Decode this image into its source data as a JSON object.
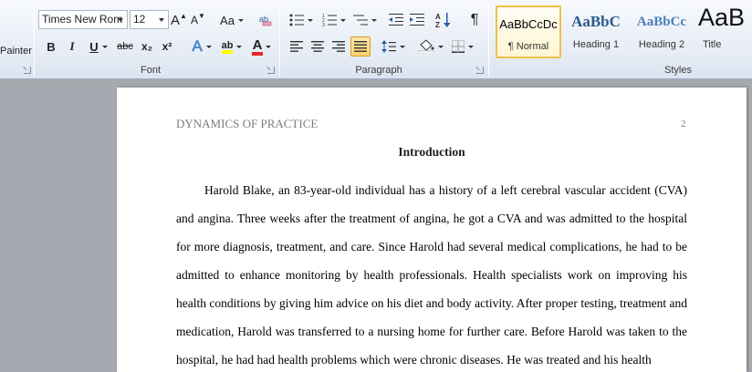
{
  "clipboard": {
    "format_painter_partial": "Painter"
  },
  "font": {
    "group_label": "Font",
    "family_value": "Times New Rom",
    "size_value": "12",
    "grow_label": "A",
    "shrink_label": "A",
    "case_label": "Aa",
    "bold": "B",
    "italic": "I",
    "underline": "U",
    "strike": "abc",
    "subscript": "x₂",
    "superscript": "x²",
    "effects": "A",
    "highlight": "ab",
    "color": "A",
    "highlight_color": "#ffff00",
    "font_color": "#e8262a"
  },
  "paragraph": {
    "group_label": "Paragraph",
    "pilcrow": "¶"
  },
  "styles": {
    "group_label": "Styles",
    "tiles": [
      {
        "preview": "AaBbCcDc",
        "name": "¶ Normal"
      },
      {
        "preview": "AaBbC",
        "name": "Heading 1"
      },
      {
        "preview": "AaBbCc",
        "name": "Heading 2"
      },
      {
        "preview": "AaB",
        "name": "Title"
      }
    ]
  },
  "document": {
    "header_left": "DYNAMICS OF PRACTICE",
    "page_number": "2",
    "title": "Introduction",
    "body": "Harold Blake, an 83-year-old individual has a history of a left cerebral vascular accident (CVA) and angina. Three weeks after the treatment of angina, he got a CVA and was admitted to the hospital for more diagnosis, treatment, and care. Since Harold had several medical complications, he had to be admitted to enhance monitoring by health professionals. Health specialists work on improving his health conditions by giving him advice on his diet and body activity. After proper testing, treatment and medication, Harold was transferred to a nursing home for further care. Before Harold was taken to the hospital, he had had health problems which were chronic diseases. He was treated and his health"
  }
}
